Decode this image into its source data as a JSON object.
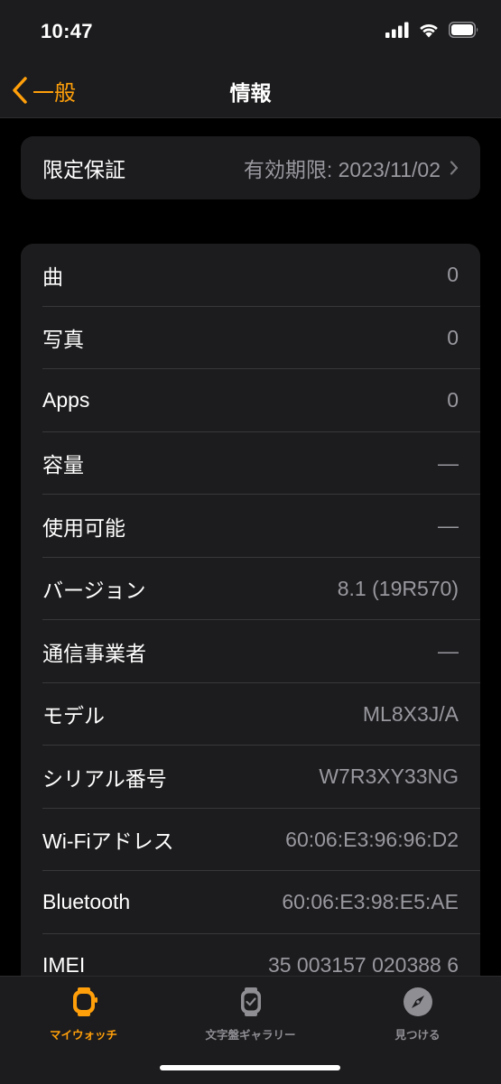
{
  "status": {
    "time": "10:47"
  },
  "nav": {
    "back_label": "一般",
    "title": "情報"
  },
  "warranty": {
    "label": "限定保証",
    "value": "有効期限: 2023/11/02"
  },
  "rows": [
    {
      "label": "曲",
      "value": "0"
    },
    {
      "label": "写真",
      "value": "0"
    },
    {
      "label": "Apps",
      "value": "0"
    },
    {
      "label": "容量",
      "value": "—"
    },
    {
      "label": "使用可能",
      "value": "—"
    },
    {
      "label": "バージョン",
      "value": "8.1 (19R570)"
    },
    {
      "label": "通信事業者",
      "value": "—"
    },
    {
      "label": "モデル",
      "value": "ML8X3J/A"
    },
    {
      "label": "シリアル番号",
      "value": "W7R3XY33NG"
    },
    {
      "label": "Wi-Fiアドレス",
      "value": "60:06:E3:96:96:D2"
    },
    {
      "label": "Bluetooth",
      "value": "60:06:E3:98:E5:AE"
    },
    {
      "label": "IMEI",
      "value": "35 003157 020388 6"
    }
  ],
  "tabs": [
    {
      "label": "マイウォッチ",
      "icon": "watch-icon",
      "active": true
    },
    {
      "label": "文字盤ギャラリー",
      "icon": "watch-face-icon",
      "active": false
    },
    {
      "label": "見つける",
      "icon": "compass-icon",
      "active": false
    }
  ],
  "colors": {
    "accent": "#ff9f0a",
    "background": "#000000",
    "cell": "#1c1c1e",
    "secondary_text": "#98989f"
  }
}
